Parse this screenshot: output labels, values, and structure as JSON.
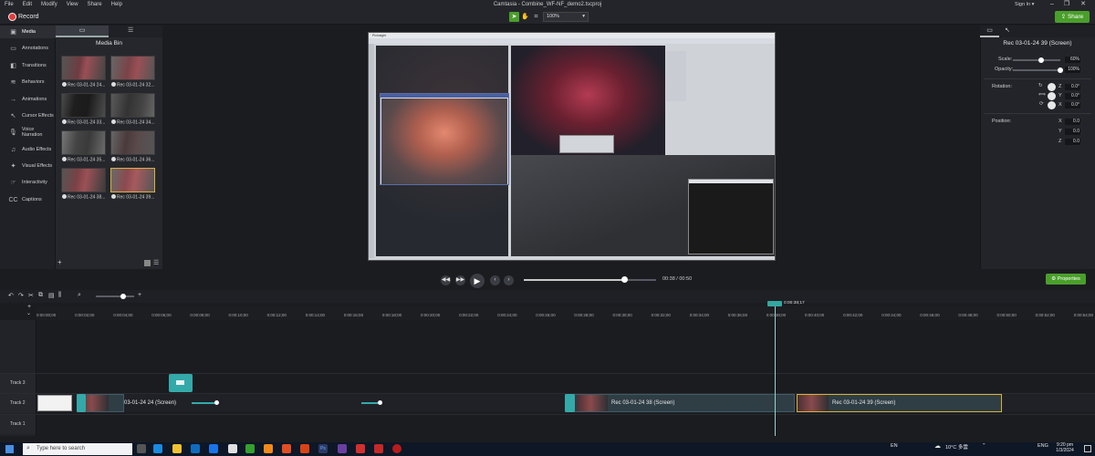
{
  "menu": [
    "File",
    "Edit",
    "Modify",
    "View",
    "Share",
    "Help"
  ],
  "window": {
    "title": "Camtasia - Combine_WF-NF_demo2.tscproj",
    "signin": "Sign In ▾"
  },
  "toolbar": {
    "record_label": "Record",
    "zoom": "100%",
    "share_label": "Share"
  },
  "leftnav": [
    {
      "label": "Media",
      "icon": "film-icon",
      "active": true
    },
    {
      "label": "Annotations",
      "icon": "annotation-icon"
    },
    {
      "label": "Transitions",
      "icon": "transition-icon"
    },
    {
      "label": "Behaviors",
      "icon": "behavior-icon"
    },
    {
      "label": "Animations",
      "icon": "animation-icon"
    },
    {
      "label": "Cursor Effects",
      "icon": "cursor-icon"
    },
    {
      "label": "Voice Narration",
      "icon": "microphone-icon"
    },
    {
      "label": "Audio Effects",
      "icon": "audio-icon"
    },
    {
      "label": "Visual Effects",
      "icon": "visual-effects-icon"
    },
    {
      "label": "Interactivity",
      "icon": "interactivity-icon"
    },
    {
      "label": "Captions",
      "icon": "captions-icon"
    }
  ],
  "mediabin": {
    "title": "Media Bin",
    "items": [
      {
        "label": "Rec 03-01-24 24..."
      },
      {
        "label": "Rec 03-01-24 32..."
      },
      {
        "label": "Rec 03-01-24 33..."
      },
      {
        "label": "Rec 03-01-24 34..."
      },
      {
        "label": "Rec 03-01-24 35..."
      },
      {
        "label": "Rec 03-01-24 36..."
      },
      {
        "label": "Rec 03-01-24 38..."
      },
      {
        "label": "Rec 03-01-24 39...",
        "selected": true
      }
    ]
  },
  "playback": {
    "current": "00:38",
    "separator": "/",
    "total": "00:50",
    "progress": 0.76,
    "properties_label": "Properties"
  },
  "properties": {
    "clip_name": "Rec 03-01-24 39 (Screen)",
    "scale_label": "Scale:",
    "scale_value": "60%",
    "scale": 0.6,
    "opacity_label": "Opacity:",
    "opacity_value": "100%",
    "opacity": 1.0,
    "rotation_label": "Rotation:",
    "rot_z": "0.0°",
    "rot_y": "0.0°",
    "rot_x": "0.0°",
    "position_label": "Position:",
    "pos_x": "0.0",
    "pos_y": "0.0",
    "pos_z": "0.0",
    "axis_z": "Z",
    "axis_y": "Y",
    "axis_x": "X"
  },
  "timeline": {
    "playhead_tc": "0:00:38;17",
    "ticks": [
      "0:00:00;00",
      "0:00:02;00",
      "0:00:04;00",
      "0:00:06;00",
      "0:00:08;00",
      "0:00:10;00",
      "0:00:12;00",
      "0:00:14;00",
      "0:00:16;00",
      "0:00:18;00",
      "0:00:20;00",
      "0:00:22;00",
      "0:00:24;00",
      "0:00:26;00",
      "0:00:28;00",
      "0:00:30;00",
      "0:00:32;00",
      "0:00:34;00",
      "0:00:36;00",
      "0:00:38;00",
      "0:00:40;00",
      "0:00:42;00",
      "0:00:44;00",
      "0:00:46;00",
      "0:00:48;00",
      "0:00:50;00",
      "0:00:52;00",
      "0:00:54;00"
    ],
    "tracks": [
      "Track 3",
      "Track 2",
      "Track 1"
    ],
    "clips": [
      {
        "label": "03-01-24 24 (Screen)"
      },
      {
        "label": "Rec 03-01-24 38 (Screen)"
      },
      {
        "label": "Rec 03-01-24 39 (Screen)"
      }
    ]
  },
  "taskbar": {
    "search_placeholder": "Type here to search",
    "weather": "10°C 多雲",
    "lang": "EN",
    "lang2": "ENG",
    "time": "9:20 pm",
    "date": "1/3/2024"
  },
  "screen_window": {
    "title": "PixInsight"
  }
}
